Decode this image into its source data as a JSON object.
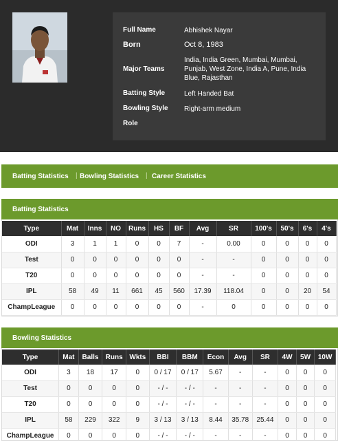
{
  "profile": {
    "fields": [
      {
        "label": "Full Name",
        "value": "Abhishek Nayar"
      },
      {
        "label": "Born",
        "value": "Oct 8, 1983"
      },
      {
        "label": "Major Teams",
        "value": "India, India Green, Mumbai, Mumbai, Punjab, West Zone, India A, Pune, India Blue, Rajasthan"
      },
      {
        "label": "Batting Style",
        "value": "Left Handed Bat"
      },
      {
        "label": "Bowling Style",
        "value": "Right-arm medium"
      },
      {
        "label": "Role",
        "value": ""
      }
    ]
  },
  "tabs": [
    "Batting Statistics",
    "Bowling Statistics",
    "Career Statistics"
  ],
  "tab_separator": "|",
  "batting": {
    "title": "Batting Statistics",
    "columns": [
      "Type",
      "Mat",
      "Inns",
      "NO",
      "Runs",
      "HS",
      "BF",
      "Avg",
      "SR",
      "100's",
      "50's",
      "6's",
      "4's"
    ],
    "rows": [
      [
        "ODI",
        "3",
        "1",
        "1",
        "0",
        "0",
        "7",
        "-",
        "0.00",
        "0",
        "0",
        "0",
        "0"
      ],
      [
        "Test",
        "0",
        "0",
        "0",
        "0",
        "0",
        "0",
        "-",
        "-",
        "0",
        "0",
        "0",
        "0"
      ],
      [
        "T20",
        "0",
        "0",
        "0",
        "0",
        "0",
        "0",
        "-",
        "-",
        "0",
        "0",
        "0",
        "0"
      ],
      [
        "IPL",
        "58",
        "49",
        "11",
        "661",
        "45",
        "560",
        "17.39",
        "118.04",
        "0",
        "0",
        "20",
        "54"
      ],
      [
        "ChampLeague",
        "0",
        "0",
        "0",
        "0",
        "0",
        "0",
        "-",
        "0",
        "0",
        "0",
        "0",
        "0"
      ]
    ]
  },
  "bowling": {
    "title": "Bowling Statistics",
    "columns": [
      "Type",
      "Mat",
      "Balls",
      "Runs",
      "Wkts",
      "BBI",
      "BBM",
      "Econ",
      "Avg",
      "SR",
      "4W",
      "5W",
      "10W"
    ],
    "rows": [
      [
        "ODI",
        "3",
        "18",
        "17",
        "0",
        "0 / 17",
        "0 / 17",
        "5.67",
        "-",
        "-",
        "0",
        "0",
        "0"
      ],
      [
        "Test",
        "0",
        "0",
        "0",
        "0",
        "- / -",
        "- / -",
        "-",
        "-",
        "-",
        "0",
        "0",
        "0"
      ],
      [
        "T20",
        "0",
        "0",
        "0",
        "0",
        "- / -",
        "- / -",
        "-",
        "-",
        "-",
        "0",
        "0",
        "0"
      ],
      [
        "IPL",
        "58",
        "229",
        "322",
        "9",
        "3 / 13",
        "3 / 13",
        "8.44",
        "35.78",
        "25.44",
        "0",
        "0",
        "0"
      ],
      [
        "ChampLeague",
        "0",
        "0",
        "0",
        "0",
        "- / -",
        "- / -",
        "-",
        "-",
        "-",
        "0",
        "0",
        "0"
      ]
    ]
  },
  "colors": {
    "accent": "#6c9a2c",
    "dark": "#2b2b2b",
    "header": "#2e2e2e"
  }
}
